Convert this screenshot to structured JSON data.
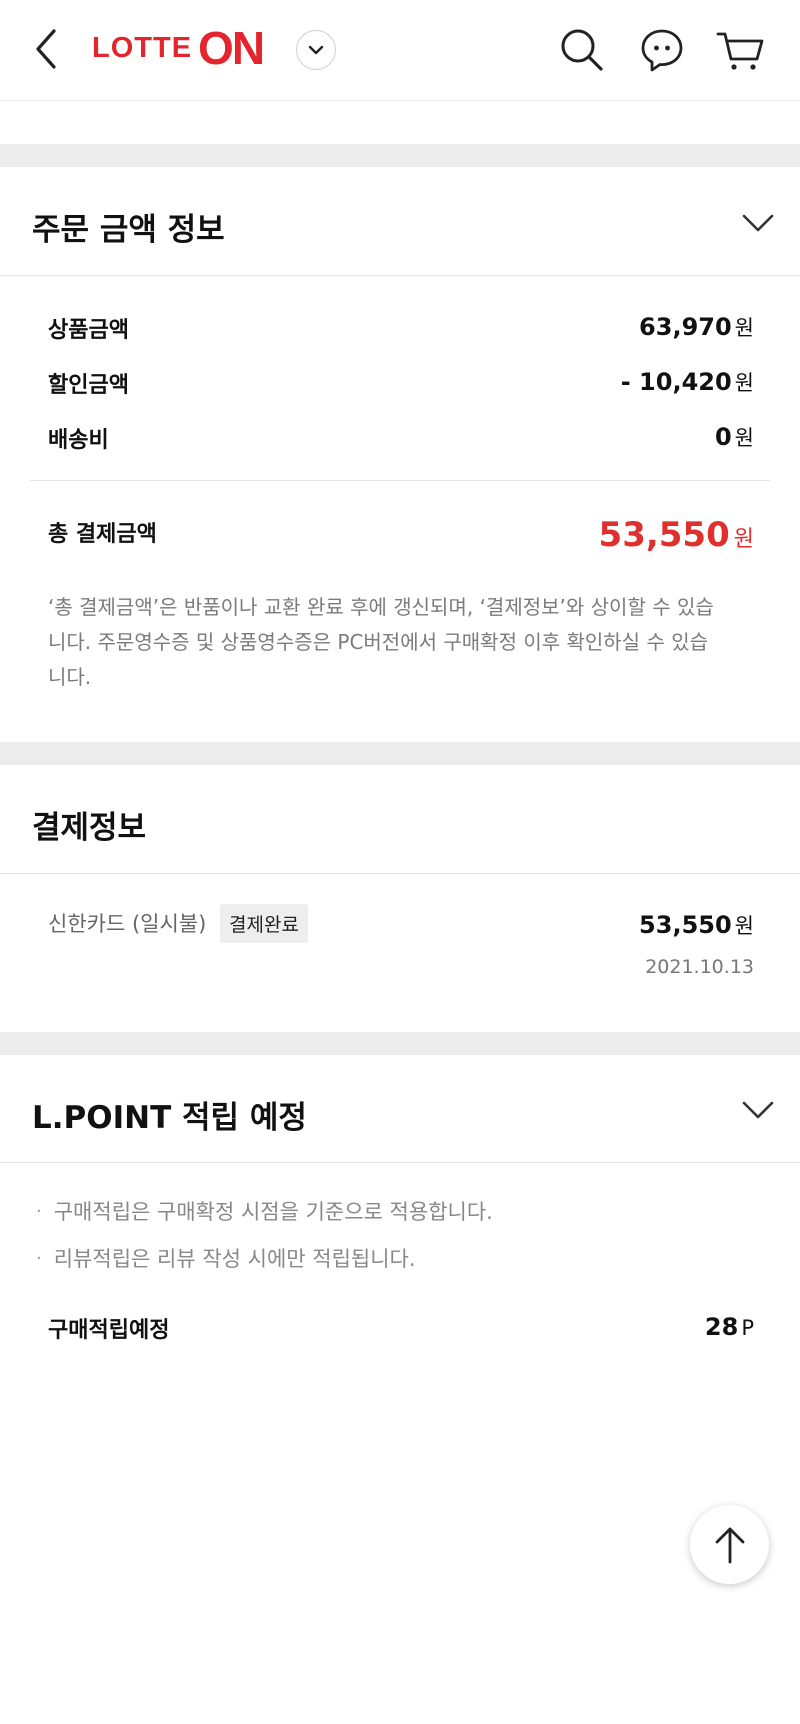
{
  "header": {
    "logo_lotte": "LOTTE",
    "logo_on": "ON",
    "icons": [
      "back-arrow-icon",
      "chevron-down-icon",
      "search-icon",
      "chat-bubble-icon",
      "cart-icon"
    ]
  },
  "order_amount": {
    "title": "주문 금액 정보",
    "product_label": "상품금액",
    "product_value": "63,970",
    "discount_label": "할인금액",
    "discount_value": "- 10,420",
    "shipping_label": "배송비",
    "shipping_value": "0",
    "unit": "원",
    "total_label": "총 결제금액",
    "total_value": "53,550",
    "notice_line1": "‘총 결제금액’은 반품이나 교환 완료 후에 갱신되며, ‘결제정보’와 상이할 수 있습",
    "notice_line2": "니다. 주문영수증 및 상품영수증은 PC버전에서 구매확정 이후 확인하실 수 있습",
    "notice_line3": "니다."
  },
  "payment": {
    "title": "결제정보",
    "method": "신한카드 (일시불)",
    "status_badge": "결제완료",
    "amount": "53,550",
    "unit": "원",
    "date": "2021.10.13"
  },
  "lpoint": {
    "title": "L.POINT 적립 예정",
    "bullet1": "구매적립은 구매확정 시점을 기준으로 적용합니다.",
    "bullet2": "리뷰적립은 리뷰 작성 시에만 적립됩니다.",
    "expected_label": "구매적립예정",
    "expected_value": "28",
    "expected_unit": "P",
    "bullet_char": "·"
  },
  "colors": {
    "brand_red": "#e3262d",
    "total_red": "#e0302d",
    "band_gray": "#ececec"
  }
}
